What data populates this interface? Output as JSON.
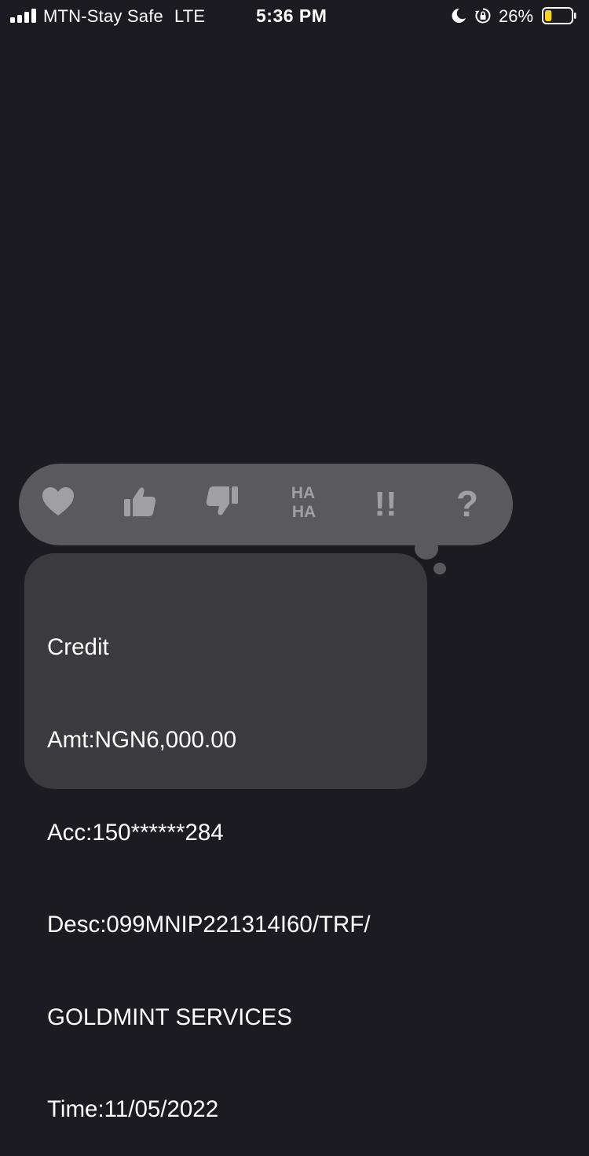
{
  "status_bar": {
    "carrier": "MTN-Stay Safe",
    "network": "LTE",
    "time": "5:36 PM",
    "battery_percent": "26%",
    "battery_level": 0.26,
    "icons": [
      "signal-bars-icon",
      "moon-icon",
      "orientation-lock-icon",
      "battery-icon"
    ]
  },
  "tapback": {
    "reactions": [
      {
        "name": "heart-icon"
      },
      {
        "name": "thumbs-up-icon"
      },
      {
        "name": "thumbs-down-icon"
      },
      {
        "name": "haha-icon",
        "text_top": "HA",
        "text_bottom": "HA"
      },
      {
        "name": "exclamation-icon",
        "text": "!!"
      },
      {
        "name": "question-icon",
        "text": "?"
      }
    ]
  },
  "message": {
    "lines": [
      "Credit",
      "Amt:NGN6,000.00",
      "Acc:150******284",
      "Desc:099MNIP221314I60/TRF/",
      "GOLDMINT SERVICES",
      "Time:11/05/2022"
    ]
  },
  "colors": {
    "background": "#1c1b21",
    "tapback_bar": "#5a595e",
    "bubble": "#3b3a3e",
    "icon": "#a09fa4",
    "battery_fill": "#f6d128"
  }
}
